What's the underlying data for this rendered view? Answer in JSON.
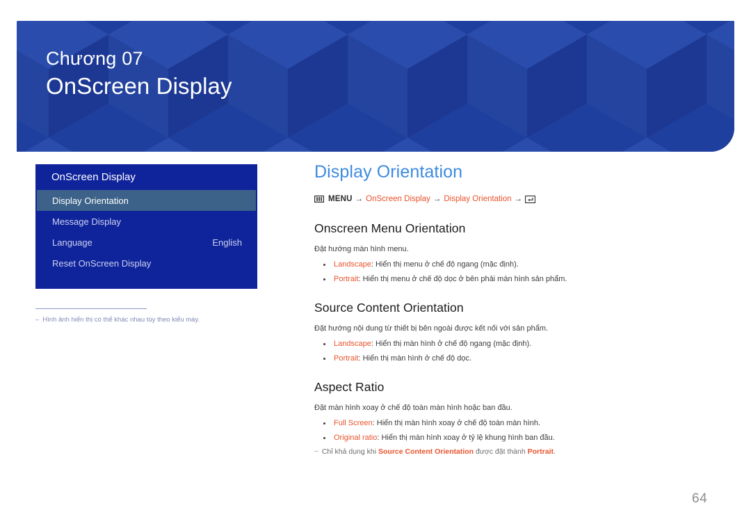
{
  "banner": {
    "chapter_label": "Chương 07",
    "chapter_title": "OnScreen Display",
    "bg_color": "#1f3f9e"
  },
  "osd_menu": {
    "header": "OnScreen Display",
    "rows": [
      {
        "label": "Display Orientation",
        "value": "",
        "selected": true
      },
      {
        "label": "Message Display",
        "value": "",
        "selected": false
      },
      {
        "label": "Language",
        "value": "English",
        "selected": false
      },
      {
        "label": "Reset OnScreen Display",
        "value": "",
        "selected": false
      }
    ],
    "selected_bg": "#3d6289",
    "panel_bg": "#0f239b"
  },
  "left_note": {
    "dash": "–",
    "text": "Hình ảnh hiển thị có thể khác nhau tùy theo kiểu máy."
  },
  "content": {
    "heading": "Display Orientation",
    "heading_color": "#3d8ae0",
    "breadcrumb": {
      "menu_icon": "menu-grid-icon",
      "menu_label": "MENU",
      "arrow1": "→",
      "crumb1": "OnScreen Display",
      "arrow2": "→",
      "crumb2": "Display Orientation",
      "arrow3": "→",
      "enter_icon": "enter-key-icon",
      "accent_color": "#e8532c"
    },
    "sections": [
      {
        "title": "Onscreen Menu Orientation",
        "desc": "Đặt hướng màn hình menu.",
        "bullets": [
          {
            "term": "Landscape",
            "rest": ": Hiển thị menu ở chế độ ngang (mặc định)."
          },
          {
            "term": "Portrait",
            "rest": ": Hiển thị menu ở chế độ dọc ở bên phải màn hình sản phẩm."
          }
        ],
        "note": null
      },
      {
        "title": "Source Content Orientation",
        "desc": "Đặt hướng nội dung từ thiết bị bên ngoài được kết nối với sản phẩm.",
        "bullets": [
          {
            "term": "Landscape",
            "rest": ": Hiển thị màn hình ở chế độ ngang (mặc định)."
          },
          {
            "term": "Portrait",
            "rest": ": Hiển thị màn hình ở chế độ dọc."
          }
        ],
        "note": null
      },
      {
        "title": "Aspect Ratio",
        "desc": "Đặt màn hình xoay ở chế độ toàn màn hình hoặc ban đầu.",
        "bullets": [
          {
            "term": "Full Screen",
            "rest": ": Hiển thị màn hình xoay ở chế độ toàn màn hình."
          },
          {
            "term": "Original ratio",
            "rest": ": Hiển thị màn hình xoay ở tỷ lệ khung hình ban đầu."
          }
        ],
        "note": {
          "dash": "‒",
          "prefix": "Chỉ khả dụng khi ",
          "term1": "Source Content Orientation",
          "middle": " được đặt thành ",
          "term2": "Portrait",
          "suffix": "."
        }
      }
    ]
  },
  "page_number": "64"
}
